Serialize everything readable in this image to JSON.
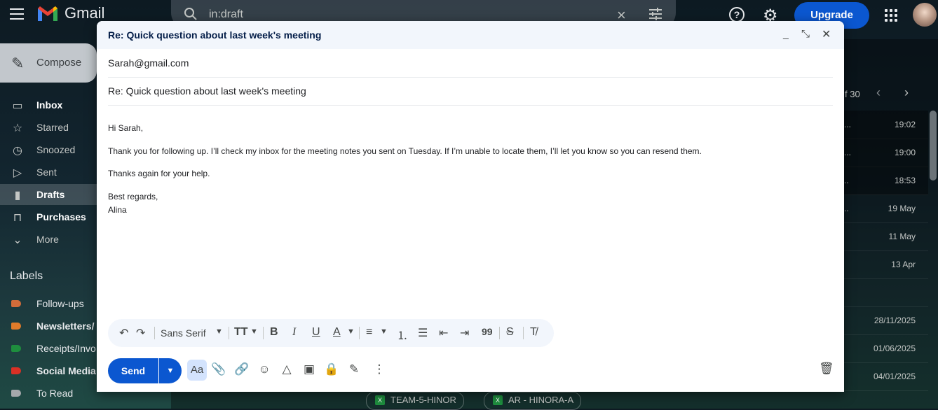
{
  "app": {
    "logo_text": "Gmail"
  },
  "search": {
    "query": "in:draft"
  },
  "header": {
    "upgrade_label": "Upgrade"
  },
  "sidebar": {
    "compose_label": "Compose",
    "items": [
      {
        "label": "Inbox",
        "icon": "inbox-icon"
      },
      {
        "label": "Starred",
        "icon": "star-icon"
      },
      {
        "label": "Snoozed",
        "icon": "clock-icon"
      },
      {
        "label": "Sent",
        "icon": "send-icon"
      },
      {
        "label": "Drafts",
        "icon": "draft-icon"
      },
      {
        "label": "Purchases",
        "icon": "bag-icon"
      },
      {
        "label": "More",
        "icon": "chevron-down-icon"
      }
    ],
    "labels_heading": "Labels",
    "labels": [
      {
        "label": "Follow-ups",
        "color": "#d36c3a"
      },
      {
        "label": "Newsletters/",
        "color": "#e07b2a"
      },
      {
        "label": "Receipts/Invo",
        "color": "#1e8e3e"
      },
      {
        "label": "Social Media",
        "color": "#d93025"
      },
      {
        "label": "To Read",
        "color": "#a5a8ab"
      }
    ]
  },
  "mail_list": {
    "page_count": "f 30",
    "rows": [
      {
        "snippet": "...",
        "time": "19:02"
      },
      {
        "snippet": "...",
        "time": "19:00"
      },
      {
        "snippet": "..",
        "time": "18:53"
      },
      {
        "snippet": "..",
        "time": "19 May"
      },
      {
        "snippet": "",
        "time": "11 May"
      },
      {
        "snippet": "",
        "time": "13 Apr"
      },
      {
        "snippet": "",
        "time": ""
      },
      {
        "snippet": "",
        "time": "28/11/2025"
      },
      {
        "snippet": "",
        "time": "01/06/2025"
      },
      {
        "snippet": "",
        "time": "04/01/2025"
      }
    ],
    "attachments": [
      "TEAM-5-HINOR",
      "AR - HINORA-A"
    ]
  },
  "compose": {
    "title": "Re: Quick question about last week's meeting",
    "to": "Sarah@gmail.com",
    "subject": "Re: Quick question about last week's meeting",
    "body": {
      "greeting": "Hi Sarah,",
      "para1": "Thank you for following up. I’ll check my inbox for the meeting notes you sent on Tuesday. If I’m unable to locate them, I’ll let you know so you can resend them.",
      "para2": "Thanks again for your help.",
      "signoff": "Best regards,",
      "name": "Alina"
    },
    "toolbar": {
      "font": "Sans Serif"
    },
    "send_label": "Send",
    "format_label": "Aa"
  },
  "colors": {
    "accent": "#0b57d0",
    "header_bg": "#f2f6fc"
  }
}
